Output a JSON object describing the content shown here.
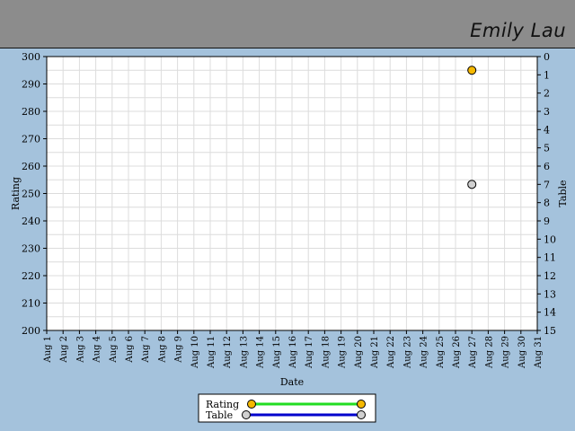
{
  "header": {
    "name": "Emily Lau"
  },
  "chart_data": {
    "type": "scatter",
    "xlabel": "Date",
    "ylabel": "Rating",
    "y2label": "Table",
    "x_categories": [
      "Aug 1",
      "Aug 2",
      "Aug 3",
      "Aug 4",
      "Aug 5",
      "Aug 6",
      "Aug 7",
      "Aug 8",
      "Aug 9",
      "Aug 10",
      "Aug 11",
      "Aug 12",
      "Aug 13",
      "Aug 14",
      "Aug 15",
      "Aug 16",
      "Aug 17",
      "Aug 18",
      "Aug 19",
      "Aug 20",
      "Aug 21",
      "Aug 22",
      "Aug 23",
      "Aug 24",
      "Aug 25",
      "Aug 26",
      "Aug 27",
      "Aug 28",
      "Aug 29",
      "Aug 30",
      "Aug 31"
    ],
    "ylim": [
      200,
      300
    ],
    "y_ticks": [
      200,
      210,
      220,
      230,
      240,
      250,
      260,
      270,
      280,
      290,
      300
    ],
    "y2lim": [
      15,
      0
    ],
    "y2_ticks": [
      0,
      1,
      2,
      3,
      4,
      5,
      6,
      7,
      8,
      9,
      10,
      11,
      12,
      13,
      14,
      15
    ],
    "grid": true,
    "series": [
      {
        "name": "Rating",
        "axis": "left",
        "color": "#f5b800",
        "line_color": "#22dd22",
        "points": [
          {
            "x": "Aug 27",
            "y": 295
          }
        ]
      },
      {
        "name": "Table",
        "axis": "right",
        "color": "#d0d0d0",
        "line_color": "#0000cc",
        "points": [
          {
            "x": "Aug 27",
            "y": 7
          }
        ]
      }
    ],
    "legend": {
      "position": "bottom-center"
    }
  }
}
